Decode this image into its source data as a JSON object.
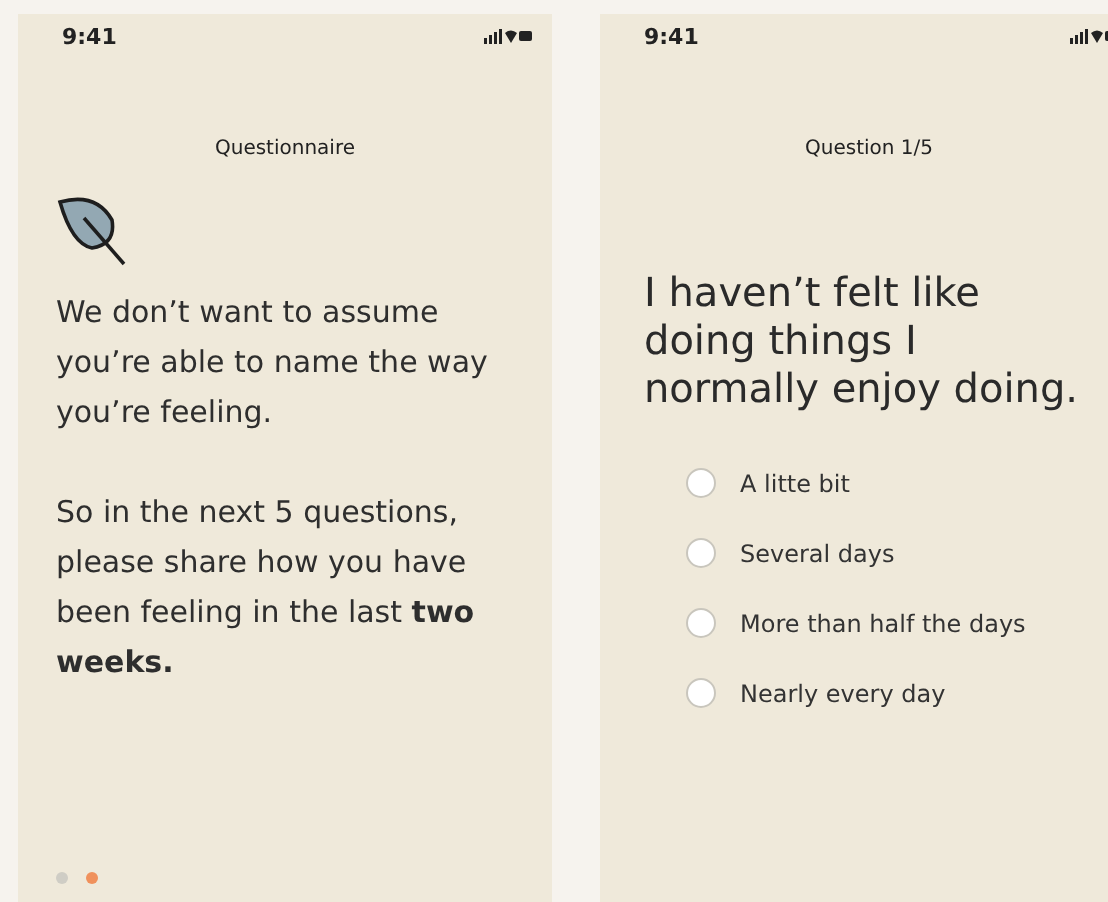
{
  "screens": [
    {
      "kind": "intro",
      "time": "9:41",
      "title": "Questionnaire",
      "paragraphs": [
        "We don’t want to assume you’re able to name the way you’re feeling.",
        "So in the next 5 questions, please share how you have been feeling in the last **two weeks.**"
      ],
      "pager": [
        {
          "selected": false
        },
        {
          "selected": true
        }
      ]
    },
    {
      "kind": "question",
      "time": "9:41",
      "title": "Question 1/5",
      "question": "I haven’t felt like doing things I normally enjoy doing.",
      "options": [
        {
          "label": "A litte bit",
          "selected": false
        },
        {
          "label": "Several days",
          "selected": false
        },
        {
          "label": "More than half the days",
          "selected": false
        },
        {
          "label": "Nearly every day",
          "selected": false
        }
      ]
    }
  ]
}
